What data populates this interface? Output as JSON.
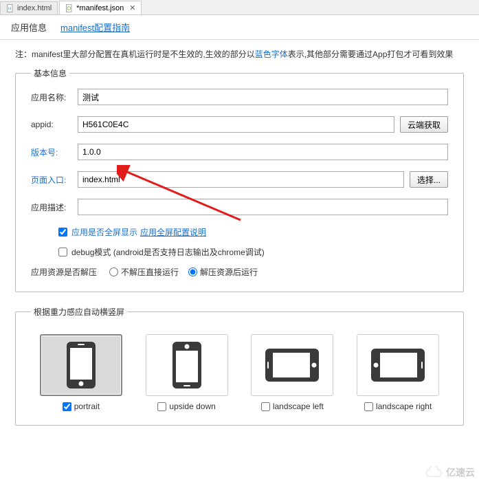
{
  "editorTabs": {
    "tab1": "index.html",
    "tab2": "*manifest.json"
  },
  "subHeader": {
    "appInfo": "应用信息",
    "guideLink": "manifest配置指南"
  },
  "note": {
    "prefix": "注：manifest里大部分配置在真机运行时是不生效的,生效的部分以",
    "blue": "蓝色字体",
    "suffix": "表示,其他部分需要通过App打包才可看到效果"
  },
  "basicInfo": {
    "legend": "基本信息",
    "appNameLabel": "应用名称:",
    "appNameValue": "测试",
    "appidLabel": "appid:",
    "appidValue": "H561C0E4C",
    "cloudBtn": "云端获取",
    "versionLabel": "版本号:",
    "versionValue": "1.0.0",
    "entryLabel": "页面入口:",
    "entryValue": "index.html",
    "selectBtn": "选择...",
    "descLabel": "应用描述:",
    "descValue": "",
    "fullscreenLabel": "应用是否全屏显示",
    "fullscreenLink": "应用全屏配置说明",
    "debugLabel": "debug模式 (android是否支持日志输出及chrome调试)",
    "decompressLabel": "应用资源是否解压",
    "radio1": "不解压直接运行",
    "radio2": "解压资源后运行"
  },
  "orientation": {
    "legend": "根据重力感应自动横竖屏",
    "portrait": "portrait",
    "upsideDown": "upside down",
    "landscapeLeft": "landscape left",
    "landscapeRight": "landscape right"
  },
  "watermark": "亿速云"
}
